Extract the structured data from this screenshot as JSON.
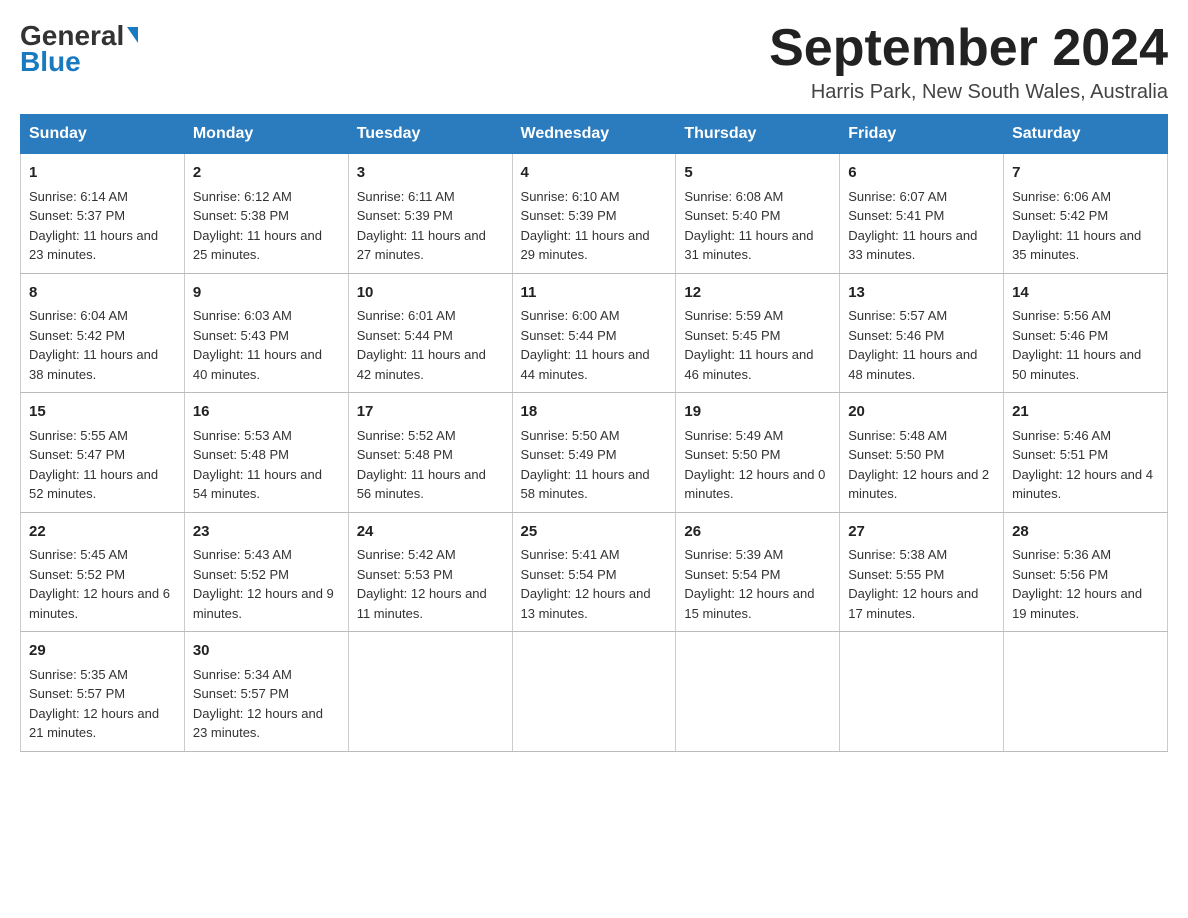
{
  "header": {
    "logo_general": "General",
    "logo_blue": "Blue",
    "month_title": "September 2024",
    "location": "Harris Park, New South Wales, Australia"
  },
  "days_of_week": [
    "Sunday",
    "Monday",
    "Tuesday",
    "Wednesday",
    "Thursday",
    "Friday",
    "Saturday"
  ],
  "weeks": [
    [
      {
        "day": "1",
        "sunrise": "6:14 AM",
        "sunset": "5:37 PM",
        "daylight": "11 hours and 23 minutes."
      },
      {
        "day": "2",
        "sunrise": "6:12 AM",
        "sunset": "5:38 PM",
        "daylight": "11 hours and 25 minutes."
      },
      {
        "day": "3",
        "sunrise": "6:11 AM",
        "sunset": "5:39 PM",
        "daylight": "11 hours and 27 minutes."
      },
      {
        "day": "4",
        "sunrise": "6:10 AM",
        "sunset": "5:39 PM",
        "daylight": "11 hours and 29 minutes."
      },
      {
        "day": "5",
        "sunrise": "6:08 AM",
        "sunset": "5:40 PM",
        "daylight": "11 hours and 31 minutes."
      },
      {
        "day": "6",
        "sunrise": "6:07 AM",
        "sunset": "5:41 PM",
        "daylight": "11 hours and 33 minutes."
      },
      {
        "day": "7",
        "sunrise": "6:06 AM",
        "sunset": "5:42 PM",
        "daylight": "11 hours and 35 minutes."
      }
    ],
    [
      {
        "day": "8",
        "sunrise": "6:04 AM",
        "sunset": "5:42 PM",
        "daylight": "11 hours and 38 minutes."
      },
      {
        "day": "9",
        "sunrise": "6:03 AM",
        "sunset": "5:43 PM",
        "daylight": "11 hours and 40 minutes."
      },
      {
        "day": "10",
        "sunrise": "6:01 AM",
        "sunset": "5:44 PM",
        "daylight": "11 hours and 42 minutes."
      },
      {
        "day": "11",
        "sunrise": "6:00 AM",
        "sunset": "5:44 PM",
        "daylight": "11 hours and 44 minutes."
      },
      {
        "day": "12",
        "sunrise": "5:59 AM",
        "sunset": "5:45 PM",
        "daylight": "11 hours and 46 minutes."
      },
      {
        "day": "13",
        "sunrise": "5:57 AM",
        "sunset": "5:46 PM",
        "daylight": "11 hours and 48 minutes."
      },
      {
        "day": "14",
        "sunrise": "5:56 AM",
        "sunset": "5:46 PM",
        "daylight": "11 hours and 50 minutes."
      }
    ],
    [
      {
        "day": "15",
        "sunrise": "5:55 AM",
        "sunset": "5:47 PM",
        "daylight": "11 hours and 52 minutes."
      },
      {
        "day": "16",
        "sunrise": "5:53 AM",
        "sunset": "5:48 PM",
        "daylight": "11 hours and 54 minutes."
      },
      {
        "day": "17",
        "sunrise": "5:52 AM",
        "sunset": "5:48 PM",
        "daylight": "11 hours and 56 minutes."
      },
      {
        "day": "18",
        "sunrise": "5:50 AM",
        "sunset": "5:49 PM",
        "daylight": "11 hours and 58 minutes."
      },
      {
        "day": "19",
        "sunrise": "5:49 AM",
        "sunset": "5:50 PM",
        "daylight": "12 hours and 0 minutes."
      },
      {
        "day": "20",
        "sunrise": "5:48 AM",
        "sunset": "5:50 PM",
        "daylight": "12 hours and 2 minutes."
      },
      {
        "day": "21",
        "sunrise": "5:46 AM",
        "sunset": "5:51 PM",
        "daylight": "12 hours and 4 minutes."
      }
    ],
    [
      {
        "day": "22",
        "sunrise": "5:45 AM",
        "sunset": "5:52 PM",
        "daylight": "12 hours and 6 minutes."
      },
      {
        "day": "23",
        "sunrise": "5:43 AM",
        "sunset": "5:52 PM",
        "daylight": "12 hours and 9 minutes."
      },
      {
        "day": "24",
        "sunrise": "5:42 AM",
        "sunset": "5:53 PM",
        "daylight": "12 hours and 11 minutes."
      },
      {
        "day": "25",
        "sunrise": "5:41 AM",
        "sunset": "5:54 PM",
        "daylight": "12 hours and 13 minutes."
      },
      {
        "day": "26",
        "sunrise": "5:39 AM",
        "sunset": "5:54 PM",
        "daylight": "12 hours and 15 minutes."
      },
      {
        "day": "27",
        "sunrise": "5:38 AM",
        "sunset": "5:55 PM",
        "daylight": "12 hours and 17 minutes."
      },
      {
        "day": "28",
        "sunrise": "5:36 AM",
        "sunset": "5:56 PM",
        "daylight": "12 hours and 19 minutes."
      }
    ],
    [
      {
        "day": "29",
        "sunrise": "5:35 AM",
        "sunset": "5:57 PM",
        "daylight": "12 hours and 21 minutes."
      },
      {
        "day": "30",
        "sunrise": "5:34 AM",
        "sunset": "5:57 PM",
        "daylight": "12 hours and 23 minutes."
      },
      null,
      null,
      null,
      null,
      null
    ]
  ],
  "labels": {
    "sunrise": "Sunrise:",
    "sunset": "Sunset:",
    "daylight": "Daylight:"
  }
}
